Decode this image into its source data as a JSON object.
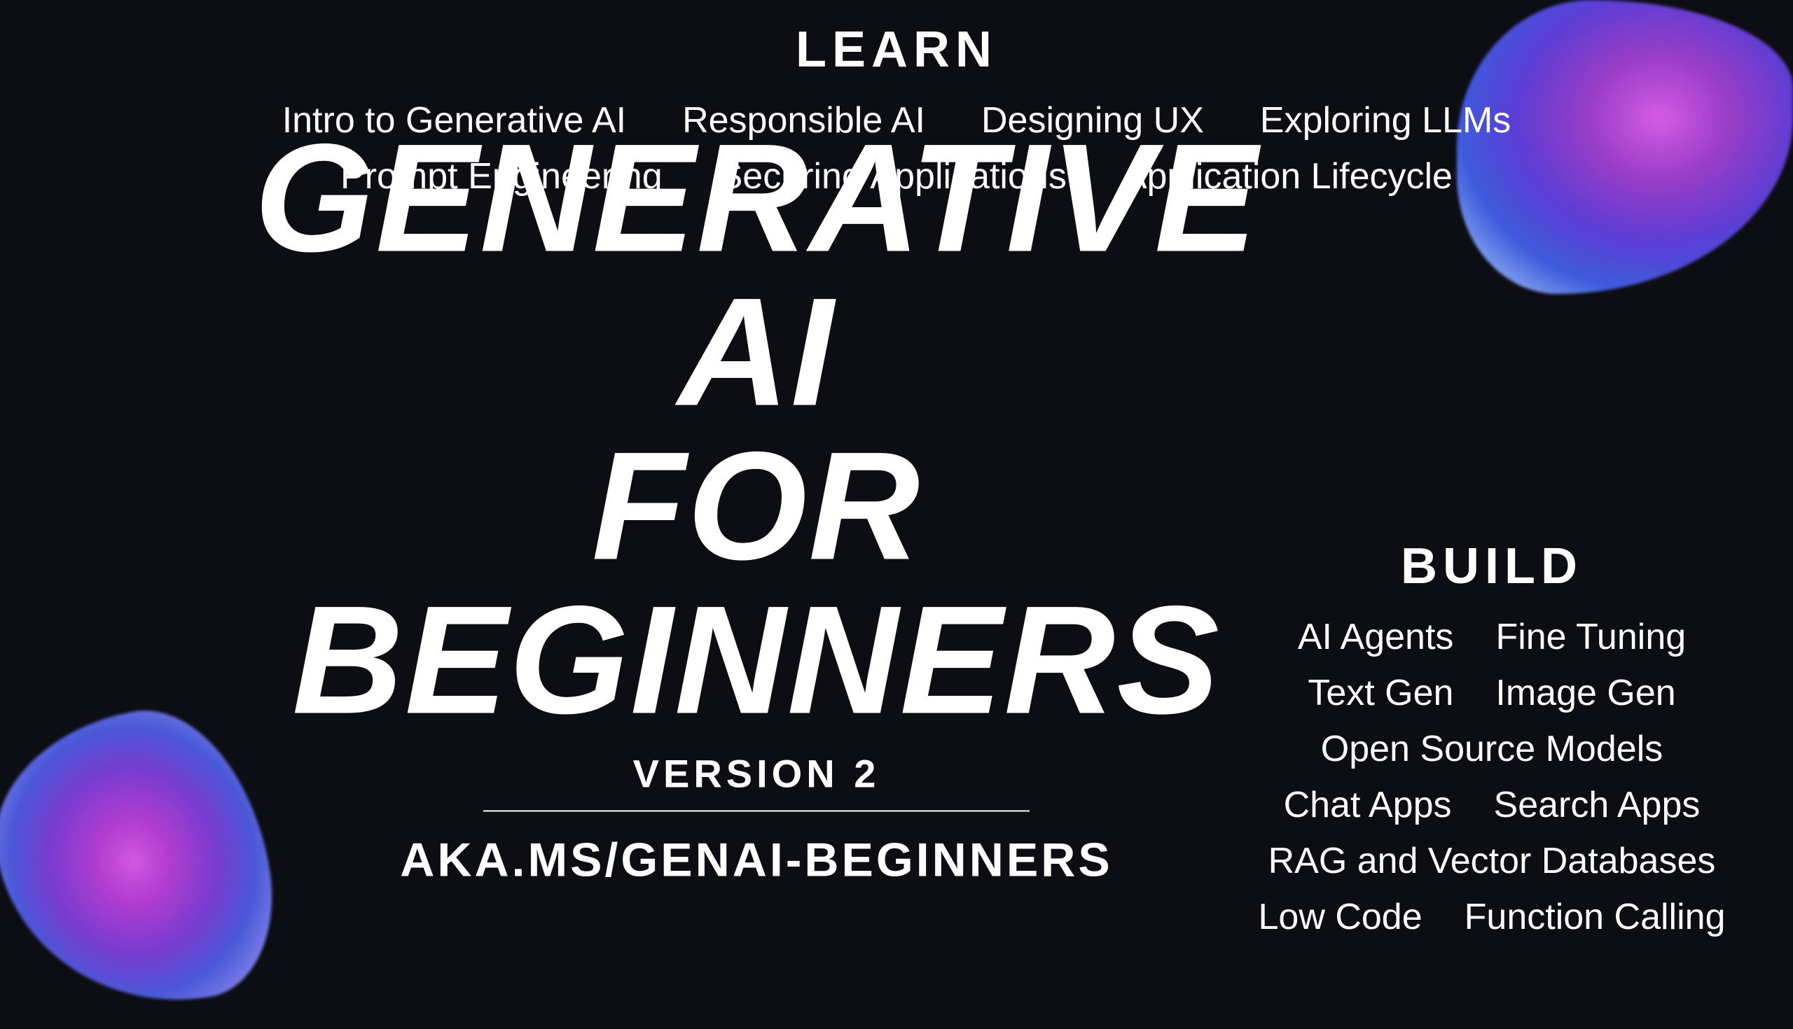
{
  "learn": {
    "title": "LEARN",
    "row1": [
      "Intro to Generative AI",
      "Responsible AI",
      "Designing UX",
      "Exploring LLMs"
    ],
    "row2": [
      "Prompt Engineering",
      "Securing Applications",
      "Application Lifecycle"
    ]
  },
  "main": {
    "title_line1": "GENERATIVE AI",
    "title_line2": "FOR",
    "title_line3": "BEGINNERS",
    "version": "VERSION 2",
    "url": "AKA.MS/GENAI-BEGINNERS"
  },
  "build": {
    "title": "BUILD",
    "row1": [
      "AI Agents",
      "Fine Tuning"
    ],
    "row2": [
      "Text Gen",
      "Image Gen"
    ],
    "row3_full": "Open Source Models",
    "row4": [
      "Chat Apps",
      "Search Apps"
    ],
    "row5_full": "RAG and Vector Databases",
    "row6": [
      "Low Code",
      "Function Calling"
    ]
  }
}
